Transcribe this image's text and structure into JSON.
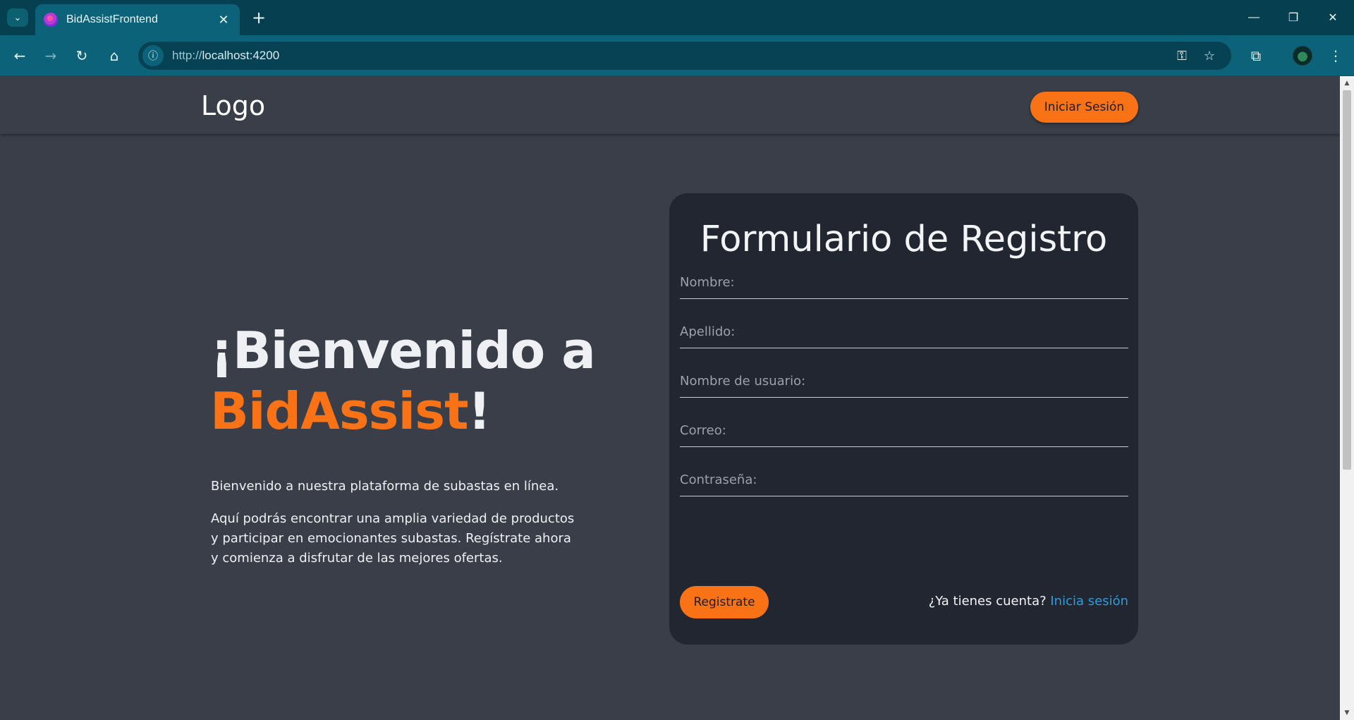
{
  "browser": {
    "tab_title": "BidAssistFrontend",
    "url_scheme": "http://",
    "url_host": "localhost:4200",
    "tab_close_glyph": "✕",
    "new_tab_glyph": "+",
    "tab_list_glyph": "⌄",
    "back_glyph": "←",
    "forward_glyph": "→",
    "reload_glyph": "↻",
    "home_glyph": "⌂",
    "site_info_glyph": "ⓘ",
    "password_glyph": "⚿",
    "star_glyph": "☆",
    "extensions_glyph": "⧉",
    "menu_glyph": "⋮",
    "minimize_glyph": "—",
    "restore_glyph": "❐",
    "close_glyph": "✕"
  },
  "navbar": {
    "logo": "Logo",
    "login_label": "Iniciar Sesión"
  },
  "hero": {
    "title_prefix": "¡Bienvenido a ",
    "title_brand": "BidAssist",
    "title_suffix": "!",
    "paragraph1": "Bienvenido a nuestra plataforma de subastas en línea.",
    "paragraph2": "Aquí podrás encontrar una amplia variedad de productos y participar en emocionantes subastas. Regístrate ahora y comienza a disfrutar de las mejores ofertas."
  },
  "form": {
    "title": "Formulario de Registro",
    "fields": [
      {
        "placeholder": "Nombre:",
        "value": ""
      },
      {
        "placeholder": "Apellido:",
        "value": ""
      },
      {
        "placeholder": "Nombre de usuario:",
        "value": ""
      },
      {
        "placeholder": "Correo:",
        "value": ""
      },
      {
        "placeholder": "Contraseña:",
        "value": ""
      }
    ],
    "register_label": "Registrate",
    "has_account_text": "¿Ya tienes cuenta? ",
    "login_link": "Inicia sesión"
  },
  "colors": {
    "accent": "#f97316",
    "link": "#2d9cdb",
    "page_bg": "#3a3e48",
    "card_bg": "#222631",
    "chrome_dark": "#063f4f",
    "chrome_toolbar": "#0c6278"
  }
}
